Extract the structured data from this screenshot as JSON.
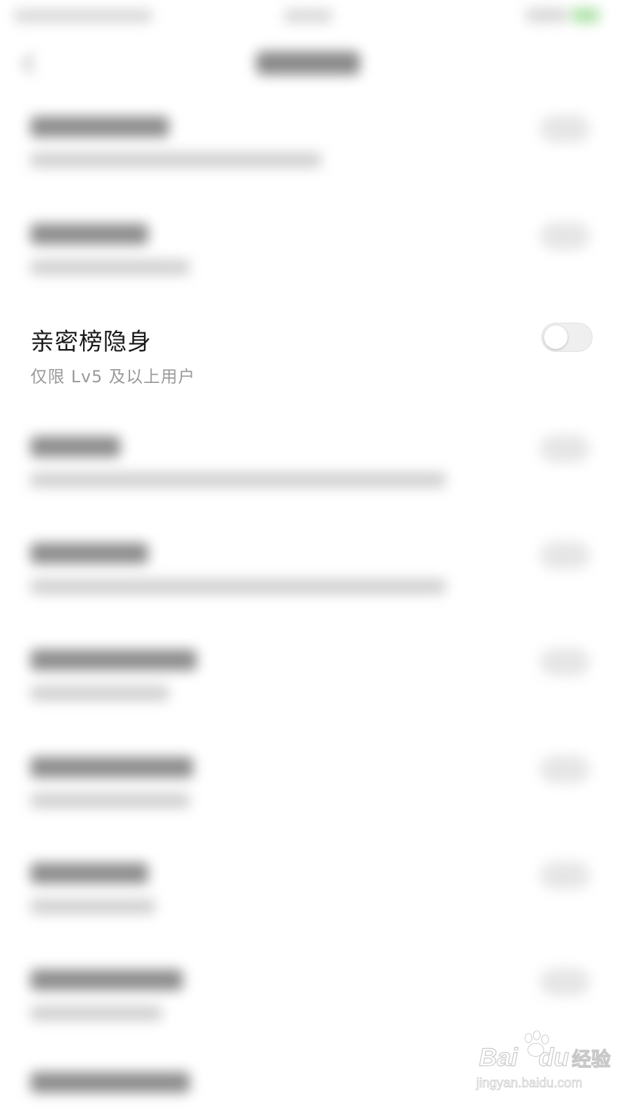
{
  "settings": {
    "focused_item": {
      "title": "亲密榜隐身",
      "subtitle": "仅限 Lv5 及以上用户",
      "toggle_on": false
    }
  },
  "watermark": {
    "brand_left": "Bai",
    "brand_right": "du",
    "brand_suffix": "经验",
    "url": "jingyan.baidu.com"
  },
  "colors": {
    "background": "#ffffff",
    "title_text": "#1b1b1b",
    "subtitle_text": "#9a9a9a",
    "toggle_off_track": "#efefef",
    "battery_accent": "#a8e0a2"
  },
  "icons": {
    "back": "back-arrow-icon",
    "toggle": "toggle-switch"
  }
}
